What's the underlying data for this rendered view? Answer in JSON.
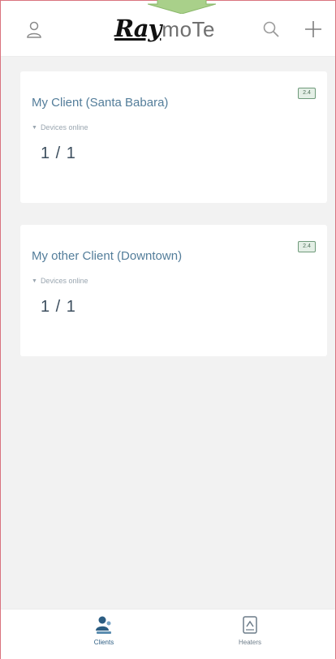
{
  "header": {
    "logo_primary": "Ray",
    "logo_secondary": "moTe",
    "profile_icon": "user-icon",
    "search_icon": "search-icon",
    "add_icon": "plus-icon"
  },
  "clients": [
    {
      "name": "My Client (Santa Babara)",
      "devices_label": "Devices online",
      "devices_count": "1 / 1",
      "badge": "2.4"
    },
    {
      "name": "My other Client (Downtown)",
      "devices_label": "Devices online",
      "devices_count": "1 / 1",
      "badge": "2.4"
    }
  ],
  "bottom_nav": {
    "items": [
      {
        "label": "Clients",
        "icon": "clients-icon",
        "active": true
      },
      {
        "label": "Heaters",
        "icon": "heater-icon",
        "active": false
      }
    ]
  },
  "colors": {
    "accent": "#537d9a",
    "active_nav": "#2c5d82",
    "frame_border": "#d9737f",
    "arrow": "#a9d08a"
  }
}
